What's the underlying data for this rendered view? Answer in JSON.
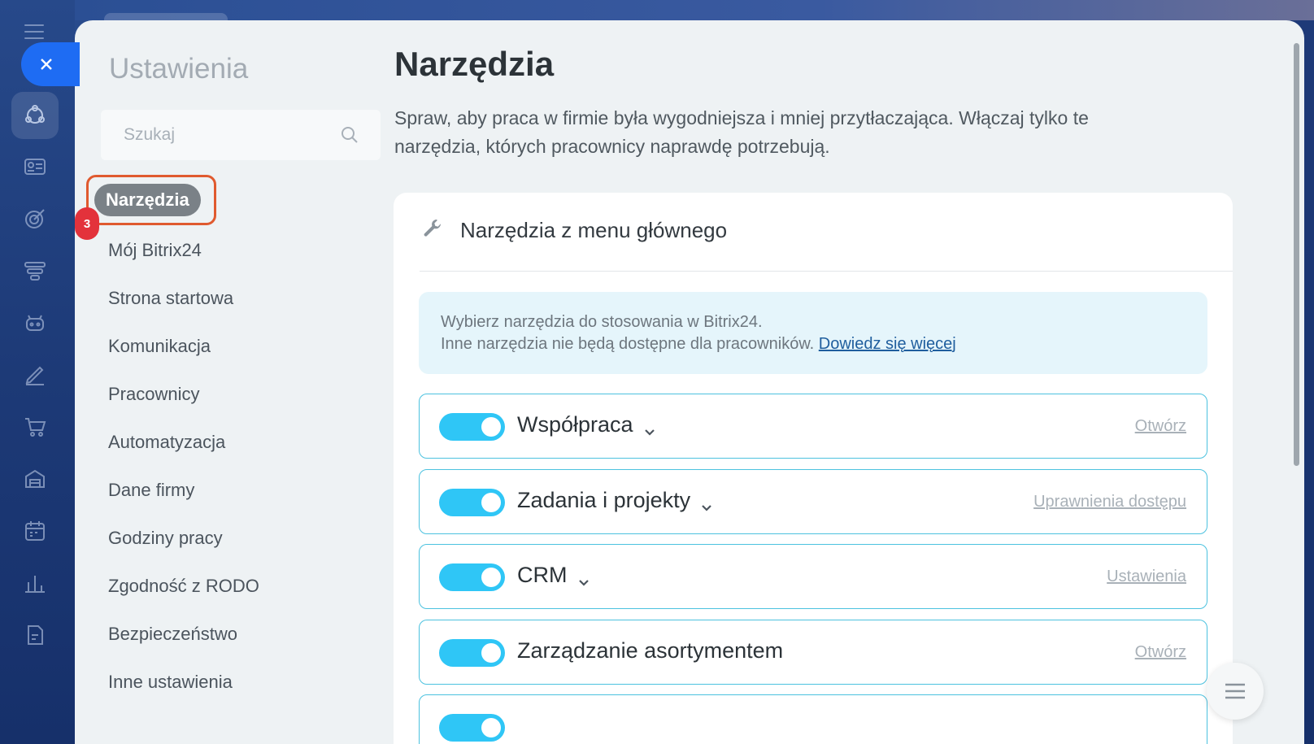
{
  "sidebar": {
    "title": "Ustawienia",
    "search": {
      "placeholder": "Szukaj"
    },
    "active_item": {
      "label": "Narzędzia",
      "badge": "3"
    },
    "items": [
      {
        "label": "Mój Bitrix24"
      },
      {
        "label": "Strona startowa"
      },
      {
        "label": "Komunikacja"
      },
      {
        "label": "Pracownicy"
      },
      {
        "label": "Automatyzacja"
      },
      {
        "label": "Dane firmy"
      },
      {
        "label": "Godziny pracy"
      },
      {
        "label": "Zgodność z RODO"
      },
      {
        "label": "Bezpieczeństwo"
      },
      {
        "label": "Inne ustawienia"
      }
    ]
  },
  "main": {
    "title": "Narzędzia",
    "description": "Spraw, aby praca w firmie była wygodniejsza i mniej przytłaczająca. Włączaj tylko te narzędzia, których pracownicy naprawdę potrzebują.",
    "card": {
      "title": "Narzędzia z menu głównego",
      "info_line1": "Wybierz narzędzia do stosowania w Bitrix24.",
      "info_line2": "Inne narzędzia nie będą dostępne dla pracowników.",
      "info_link": "Dowiedz się więcej",
      "tools": [
        {
          "name": "Współpraca",
          "enabled": true,
          "expandable": true,
          "action": "Otwórz"
        },
        {
          "name": "Zadania i projekty",
          "enabled": true,
          "expandable": true,
          "action": "Uprawnienia dostępu"
        },
        {
          "name": "CRM",
          "enabled": true,
          "expandable": true,
          "action": "Ustawienia"
        },
        {
          "name": "Zarządzanie asortymentem",
          "enabled": true,
          "expandable": false,
          "action": "Otwórz"
        }
      ]
    }
  },
  "colors": {
    "accent": "#2fc6f6",
    "highlight_border": "#e05a2f",
    "badge": "#e3323b",
    "close_button": "#1e6cf3"
  }
}
